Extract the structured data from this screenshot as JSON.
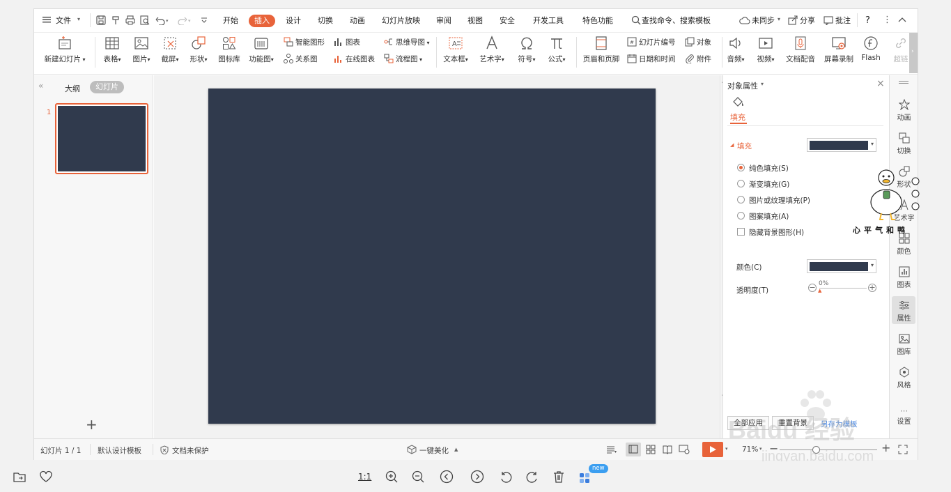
{
  "menubar": {
    "file_label": "文件",
    "tabs": [
      {
        "label": "开始"
      },
      {
        "label": "插入"
      },
      {
        "label": "设计"
      },
      {
        "label": "切换"
      },
      {
        "label": "动画"
      },
      {
        "label": "幻灯片放映"
      },
      {
        "label": "审阅"
      },
      {
        "label": "视图"
      },
      {
        "label": "安全"
      },
      {
        "label": "开发工具"
      },
      {
        "label": "特色功能"
      }
    ],
    "active_tab": "插入",
    "search_label": "查找命令、搜索模板",
    "sync_label": "未同步",
    "share_label": "分享",
    "comment_label": "批注",
    "help_label": "?"
  },
  "ribbon": {
    "new_slide": "新建幻灯片",
    "table": "表格",
    "picture": "图片",
    "screenshot": "截屏",
    "shape": "形状",
    "icon_lib": "图标库",
    "function_chart": "功能图",
    "smart_art": "智能图形",
    "relation": "关系图",
    "chart": "图表",
    "online_chart": "在线图表",
    "mind_map": "思维导图",
    "flow_chart": "流程图",
    "textbox": "文本框",
    "word_art": "艺术字",
    "symbol": "符号",
    "formula": "公式",
    "header_footer": "页眉和页脚",
    "slide_number": "幻灯片编号",
    "date_time": "日期和时间",
    "object": "对象",
    "attachment": "附件",
    "audio": "音频",
    "video": "视频",
    "doc_voice": "文档配音",
    "screen_record": "屏幕录制",
    "flash": "Flash",
    "hyperlink": "超链"
  },
  "left_panel": {
    "outline_tab": "大纲",
    "slides_tab": "幻灯片",
    "slide_number": "1",
    "add_label": "+"
  },
  "slide": {
    "background": "#303a4d"
  },
  "properties": {
    "title": "对象属性",
    "fill_tab": "填充",
    "fill_section": "填充",
    "options": [
      {
        "label": "纯色填充(S)",
        "selected": true
      },
      {
        "label": "渐变填充(G)",
        "selected": false
      },
      {
        "label": "图片或纹理填充(P)",
        "selected": false
      },
      {
        "label": "图案填充(A)",
        "selected": false
      }
    ],
    "hide_bg_label": "隐藏背景图形(H)",
    "color_label": "颜色(C)",
    "transparency_label": "透明度(T)",
    "transparency_value": "0%",
    "fill_color": "#303a4d",
    "apply_all": "全部应用",
    "reset_bg": "重置背景",
    "save_template": "另存为模板"
  },
  "right_toolbar": {
    "items": [
      {
        "label": "动画"
      },
      {
        "label": "切换"
      },
      {
        "label": "形状"
      },
      {
        "label": "艺术字"
      },
      {
        "label": "颜色"
      },
      {
        "label": "图表"
      },
      {
        "label": "属性"
      },
      {
        "label": "图库"
      },
      {
        "label": "风格"
      },
      {
        "label": "设置"
      }
    ]
  },
  "status": {
    "slide_count": "幻灯片 1 / 1",
    "template": "默认设计模板",
    "protection": "文档未保护",
    "beautify": "一键美化",
    "zoom": "71%"
  },
  "bottombar": {
    "ratio_label": "1:1",
    "new_badge": "new"
  },
  "watermark": {
    "duck_caption": "心平气和鸭",
    "baidu_text": "Baidu 经验",
    "baidu_url": "jingyan.baidu.com"
  },
  "colors": {
    "accent": "#e8633a",
    "slide_bg": "#303a4d"
  }
}
